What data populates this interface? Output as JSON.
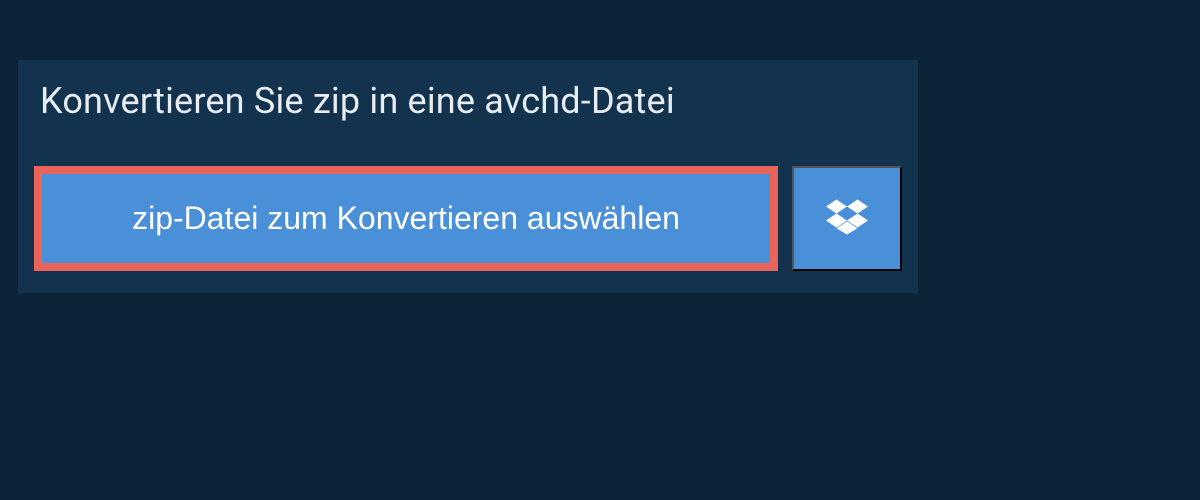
{
  "title": "Konvertieren Sie zip in eine avchd-Datei",
  "buttons": {
    "select_file_label": "zip-Datei zum Konvertieren auswählen",
    "dropbox_icon": "dropbox-icon"
  },
  "colors": {
    "page_bg": "#0d2438",
    "panel_bg": "#12324d",
    "button_bg": "#4a90d9",
    "highlight_border": "#e8645a",
    "text_light": "#e8edf2",
    "text_white": "#ffffff"
  }
}
